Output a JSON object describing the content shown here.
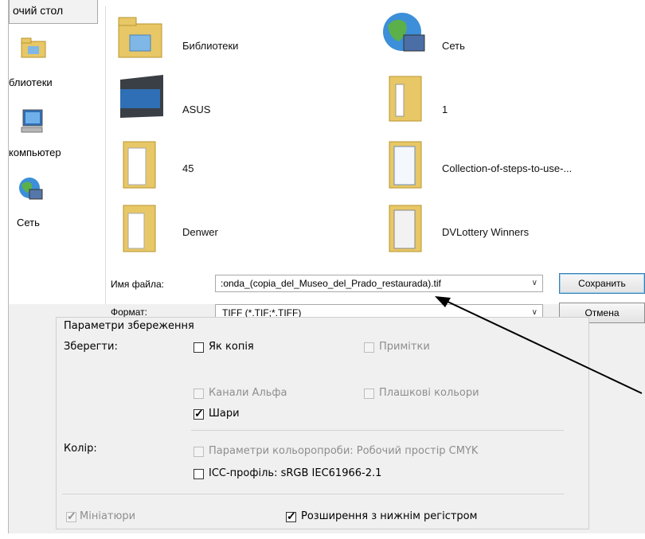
{
  "sidebar": {
    "desktop_button": "очий стол",
    "items": [
      {
        "label": "блиотеки",
        "icon": "libraries-icon"
      },
      {
        "label": "компьютер",
        "icon": "computer-icon"
      },
      {
        "label": "Сеть",
        "icon": "network-icon"
      }
    ]
  },
  "files": [
    {
      "name": "Библиотеки",
      "icon": "libraries-folder-icon"
    },
    {
      "name": "Сеть",
      "icon": "network-globe-icon"
    },
    {
      "name": "ASUS",
      "icon": "asus-drive-icon"
    },
    {
      "name": "1",
      "icon": "folder-icon"
    },
    {
      "name": "45",
      "icon": "folder-icon"
    },
    {
      "name": "Collection-of-steps-to-use-...",
      "icon": "folder-icon"
    },
    {
      "name": "Denwer",
      "icon": "folder-icon"
    },
    {
      "name": "DVLottery Winners",
      "icon": "folder-icon"
    }
  ],
  "filename": {
    "label": "Имя файла:",
    "value": ":onda_(copia_del_Museo_del_Prado_restaurada).tif"
  },
  "format": {
    "label": "Формат:",
    "value": "TIFF (*.TIF;*.TIFF)"
  },
  "buttons": {
    "save": "Сохранить",
    "cancel": "Отмена"
  },
  "options": {
    "group_title": "Параметри збереження",
    "save_label": "Зберегти:",
    "as_copy": "Як копія",
    "notes": "Примітки",
    "alpha": "Канали Альфа",
    "spot": "Плашкові кольори",
    "layers": "Шари",
    "color_label": "Колір:",
    "proof": "Параметри кольоропроби:  Робочий простір CMYK",
    "icc": "ICC-профіль:  sRGB IEC61966-2.1",
    "thumbnails": "Мініатюри",
    "lowercase_ext": "Розширення з нижнім регістром"
  },
  "colors": {
    "folder": "#e8c766",
    "accent": "#3c7fb1",
    "arrow": "#000000"
  }
}
